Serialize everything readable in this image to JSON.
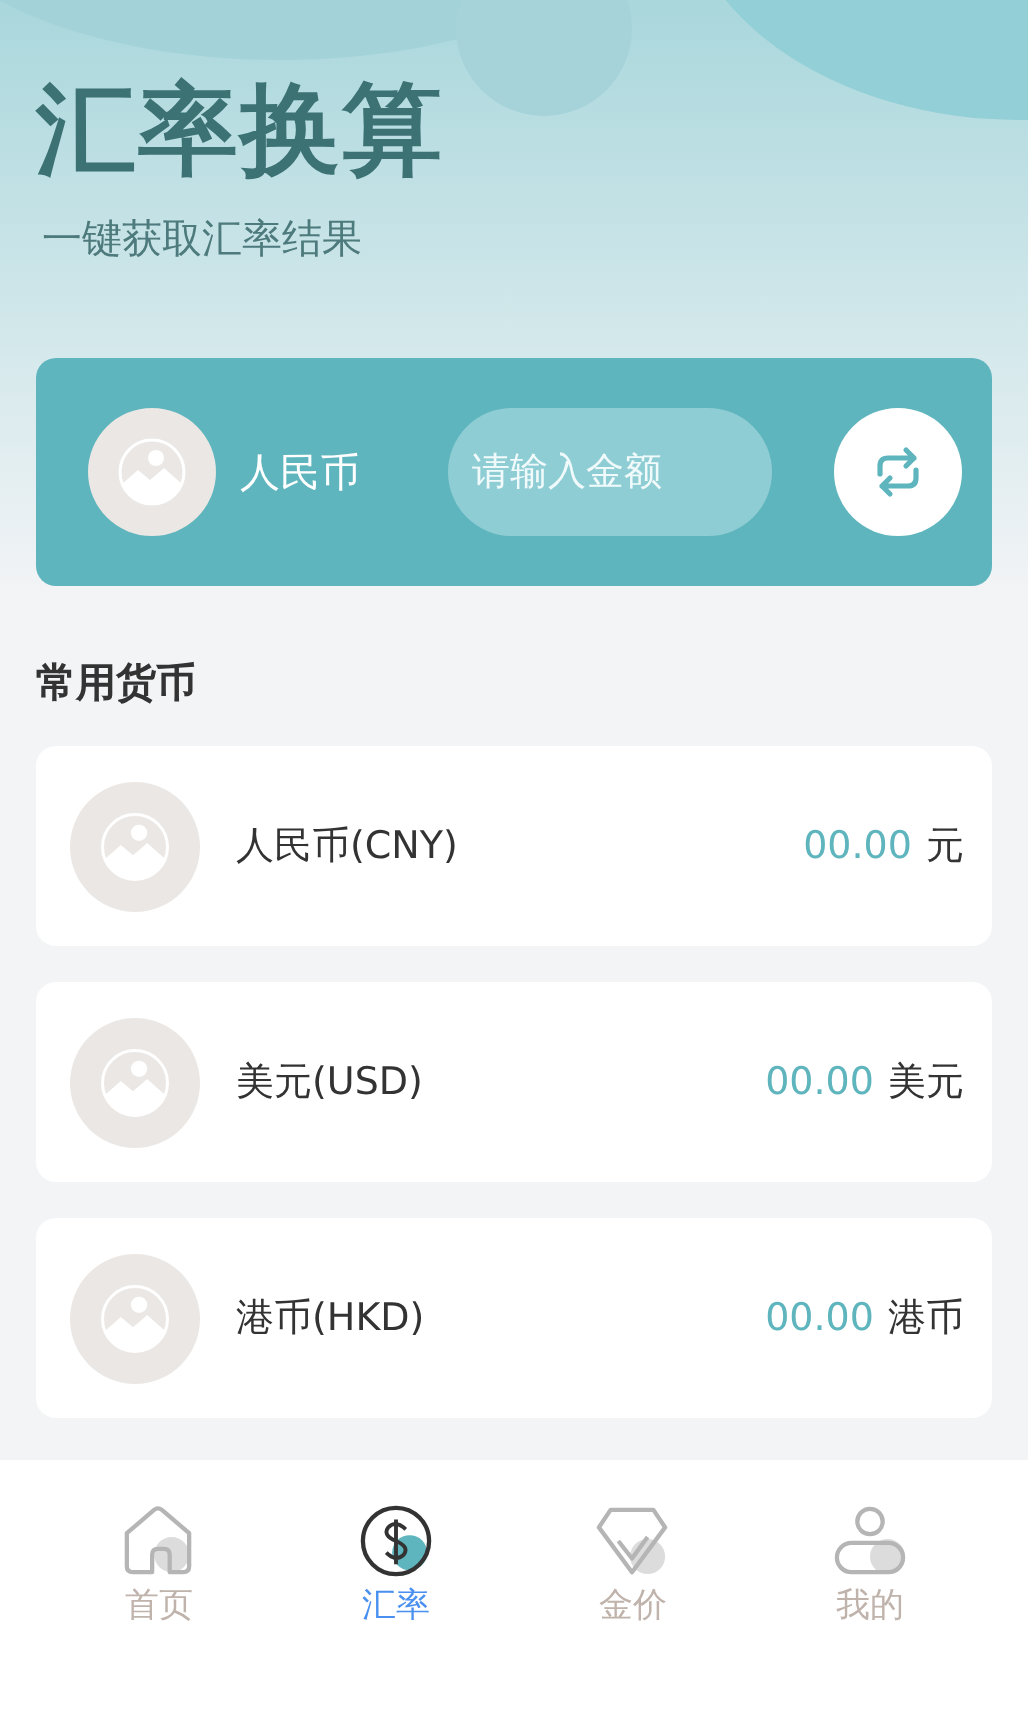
{
  "header": {
    "title": "汇率换算",
    "subtitle": "一键获取汇率结果"
  },
  "converter": {
    "currency": "人民币",
    "amount_field": {
      "placeholder": "请输入金额"
    }
  },
  "section_title": "常用货币",
  "currencies": [
    {
      "name": "人民币(CNY)",
      "amount": "00.00",
      "unit": "元"
    },
    {
      "name": "美元(USD)",
      "amount": "00.00",
      "unit": "美元"
    },
    {
      "name": "港币(HKD)",
      "amount": "00.00",
      "unit": "港币"
    }
  ],
  "tab_bar": [
    {
      "label": "首页",
      "kind": "home",
      "selected": false
    },
    {
      "label": "汇率",
      "kind": "dollar",
      "selected": true
    },
    {
      "label": "金价",
      "kind": "diamond",
      "selected": false
    },
    {
      "label": "我的",
      "kind": "user",
      "selected": false
    }
  ]
}
